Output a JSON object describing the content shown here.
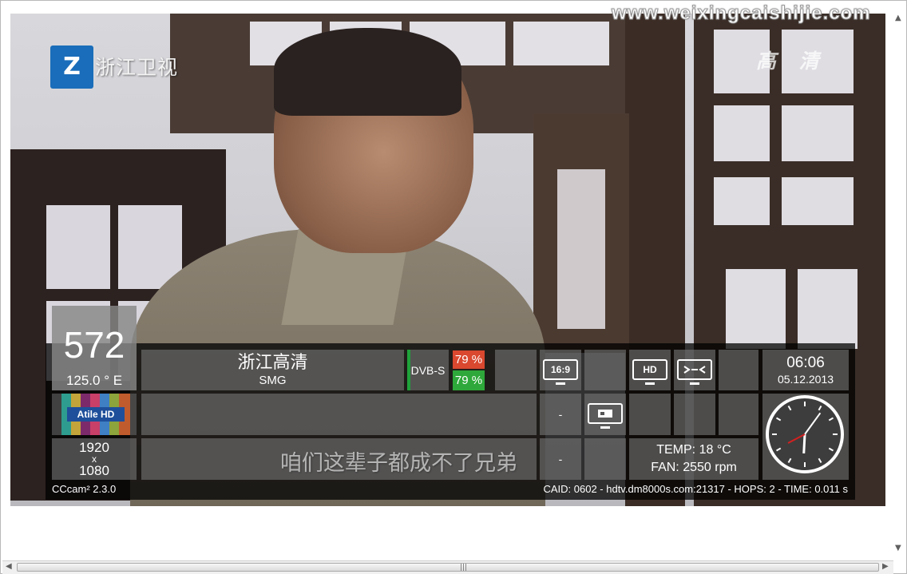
{
  "overlay": {
    "watermark": "www.weixingcaishijie.com",
    "logo_text": "浙江卫视",
    "hd_mark": "高 清",
    "subtitle": "咱们这辈子都成不了兄弟"
  },
  "infobar": {
    "channel_number": "572",
    "orbital_position": "125.0 ° E",
    "channel_name": "浙江高清",
    "provider": "SMG",
    "system": "DVB-S",
    "signal_strength": "79 %",
    "signal_quality": "79 %",
    "aspect_icon_label": "16:9",
    "hd_icon_label": "HD",
    "time": "06:06",
    "date": "05.12.2013",
    "picon_label": "Atile HD",
    "resolution_width": "1920",
    "resolution_x": "x",
    "resolution_height": "1080",
    "dash1": "-",
    "dash2": "-",
    "temp": "TEMP: 18 °C",
    "fan": "FAN: 2550 rpm",
    "emu": "CCcam² 2.3.0",
    "ecm_info": "CAID: 0602 - hdtv.dm8000s.com:21317 - HOPS: 2 - TIME: 0.011 s",
    "clock_hands": {
      "hour": 6.1,
      "minute": 6
    }
  },
  "icons": {
    "logo": "zhejiang-tv-logo",
    "aspect": "tv-16-9-icon",
    "hd": "tv-hd-icon",
    "satellite": "tv-signal-icon",
    "card": "tv-smartcard-icon",
    "clock": "analog-clock-icon"
  },
  "colors": {
    "signal_red": "#d9482f",
    "signal_green": "#2ea83a",
    "picon_blue": "#1f4f9a"
  }
}
